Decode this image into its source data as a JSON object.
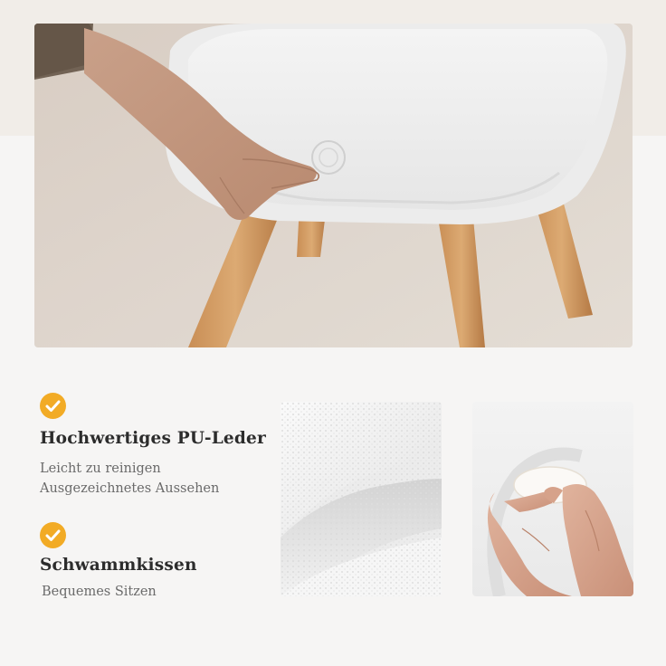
{
  "features": [
    {
      "icon": "check-circle-icon",
      "title": "Hochwertiges PU-Leder",
      "lines": [
        "Leicht zu reinigen",
        "Ausgezeichnetes Aussehen"
      ]
    },
    {
      "icon": "check-circle-icon",
      "title": "Schwammkissen",
      "lines": [
        "Bequemes Sitzen"
      ]
    }
  ],
  "colors": {
    "accent": "#f2ab25",
    "title": "#2c2c2c",
    "subtitle": "#6a6a6a"
  }
}
